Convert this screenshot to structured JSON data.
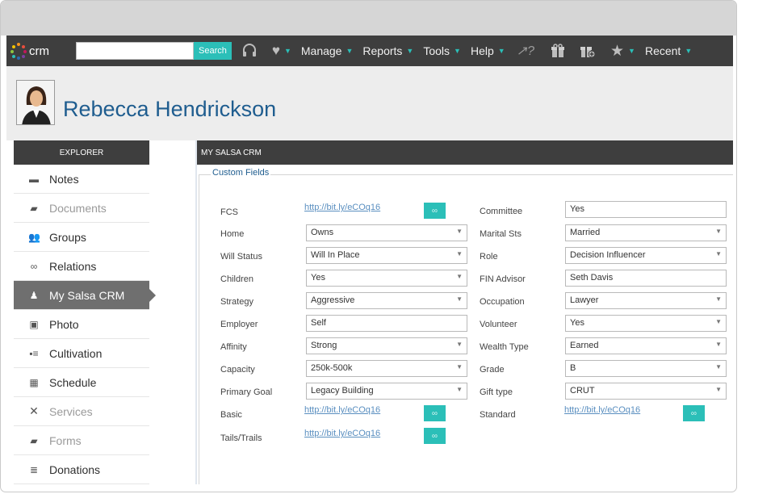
{
  "colors": {
    "accent": "#2bbfb8",
    "dark_bar": "#3e3e3e",
    "name_blue": "#1f5d8f",
    "link": "#5a8fc0"
  },
  "topnav": {
    "logo": "crm",
    "search_value": "",
    "search_button": "Search",
    "icons": [
      "headset-icon",
      "heart-icon",
      "question-icon",
      "gift-icon",
      "gift-add-icon",
      "star-icon"
    ],
    "menus": [
      "Manage",
      "Reports",
      "Tools",
      "Help",
      "Recent"
    ]
  },
  "contact": {
    "name": "Rebecca Hendrickson"
  },
  "sidebar": {
    "header": "EXPLORER",
    "items": [
      {
        "label": "Notes",
        "icon": "notes-icon"
      },
      {
        "label": "Documents",
        "icon": "folder-icon"
      },
      {
        "label": "Groups",
        "icon": "groups-icon"
      },
      {
        "label": "Relations",
        "icon": "link-icon"
      },
      {
        "label": "My Salsa CRM",
        "icon": "user-add-icon",
        "active": true
      },
      {
        "label": "Photo",
        "icon": "photo-icon"
      },
      {
        "label": "Cultivation",
        "icon": "cultivation-icon"
      },
      {
        "label": "Schedule",
        "icon": "calendar-icon"
      },
      {
        "label": "Services",
        "icon": "tools-icon"
      },
      {
        "label": "Forms",
        "icon": "forms-icon"
      },
      {
        "label": "Donations",
        "icon": "donations-icon"
      }
    ]
  },
  "panel": {
    "header": "MY SALSA CRM",
    "legend": "Custom Fields",
    "left_fields": [
      {
        "label": "FCS",
        "type": "link",
        "value": "http://bit.ly/eCOq16",
        "button": "∞"
      },
      {
        "label": "Home",
        "type": "select",
        "value": "Owns"
      },
      {
        "label": "Will Status",
        "type": "select",
        "value": "Will In Place"
      },
      {
        "label": "Children",
        "type": "select",
        "value": "Yes"
      },
      {
        "label": "Strategy",
        "type": "select",
        "value": "Aggressive"
      },
      {
        "label": "Employer",
        "type": "text",
        "value": "Self"
      },
      {
        "label": "Affinity",
        "type": "select",
        "value": "Strong"
      },
      {
        "label": "Capacity",
        "type": "select",
        "value": "250k-500k"
      },
      {
        "label": "Primary Goal",
        "type": "select",
        "value": "Legacy Building"
      },
      {
        "label": "Basic",
        "type": "link",
        "value": "http://bit.ly/eCOq16",
        "button": "∞"
      },
      {
        "label": "Tails/Trails",
        "type": "link",
        "value": "http://bit.ly/eCOq16",
        "button": "∞"
      }
    ],
    "right_fields": [
      {
        "label": "Committee",
        "type": "text",
        "value": "Yes"
      },
      {
        "label": "Marital Sts",
        "type": "select",
        "value": "Married"
      },
      {
        "label": "Role",
        "type": "select",
        "value": "Decision Influencer"
      },
      {
        "label": "FIN Advisor",
        "type": "text",
        "value": "Seth Davis"
      },
      {
        "label": "Occupation",
        "type": "select",
        "value": "Lawyer"
      },
      {
        "label": "Volunteer",
        "type": "select",
        "value": "Yes"
      },
      {
        "label": "Wealth Type",
        "type": "select",
        "value": "Earned"
      },
      {
        "label": "Grade",
        "type": "select",
        "value": "B"
      },
      {
        "label": "Gift type",
        "type": "select",
        "value": "CRUT"
      },
      {
        "label": "Standard",
        "type": "link",
        "value": "http://bit.ly/eCOq16",
        "button": "∞"
      }
    ]
  }
}
